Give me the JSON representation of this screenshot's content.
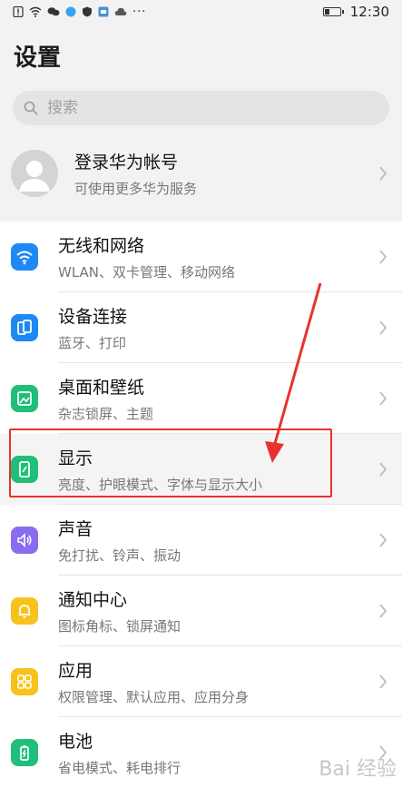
{
  "status": {
    "time": "12:30",
    "more": "···"
  },
  "page": {
    "title": "设置"
  },
  "search": {
    "placeholder": "搜索"
  },
  "account": {
    "title": "登录华为帐号",
    "subtitle": "可使用更多华为服务"
  },
  "settings": [
    {
      "title": "无线和网络",
      "subtitle": "WLAN、双卡管理、移动网络",
      "color": "#1e88f5",
      "icon": "wifi-icon"
    },
    {
      "title": "设备连接",
      "subtitle": "蓝牙、打印",
      "color": "#1e88f5",
      "icon": "device-connect-icon"
    },
    {
      "title": "桌面和壁纸",
      "subtitle": "杂志锁屏、主题",
      "color": "#1fbf7a",
      "icon": "wallpaper-icon"
    },
    {
      "title": "显示",
      "subtitle": "亮度、护眼模式、字体与显示大小",
      "color": "#1fbf7a",
      "icon": "display-icon"
    },
    {
      "title": "声音",
      "subtitle": "免打扰、铃声、振动",
      "color": "#8a6cf0",
      "icon": "sound-icon"
    },
    {
      "title": "通知中心",
      "subtitle": "图标角标、锁屏通知",
      "color": "#f6c21b",
      "icon": "bell-icon"
    },
    {
      "title": "应用",
      "subtitle": "权限管理、默认应用、应用分身",
      "color": "#f6c21b",
      "icon": "apps-grid-icon"
    },
    {
      "title": "电池",
      "subtitle": "省电模式、耗电排行",
      "color": "#1fbf7a",
      "icon": "battery-icon"
    }
  ],
  "watermark": "Bai 经验"
}
